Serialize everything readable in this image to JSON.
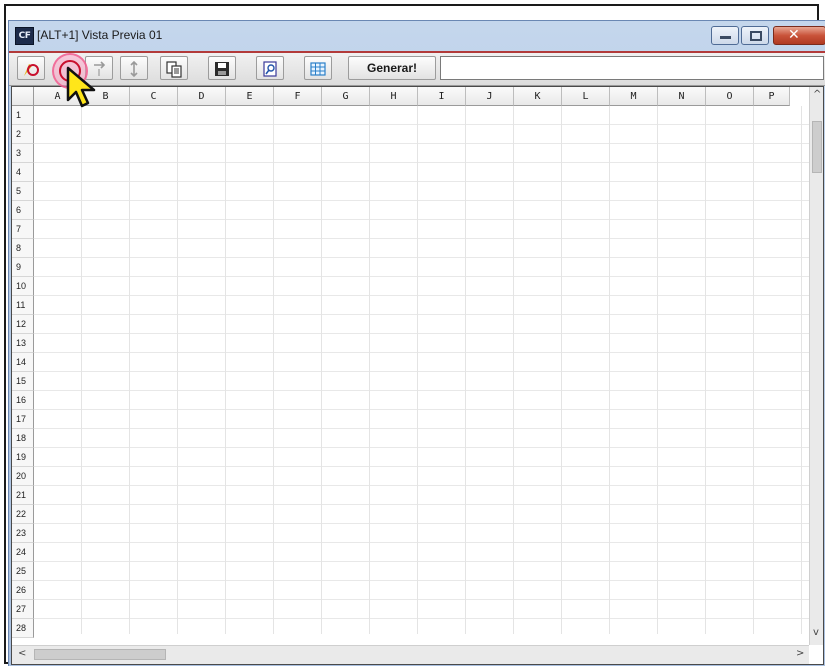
{
  "window": {
    "app_icon_text": "CF",
    "title": "[ALT+1] Vista Previa 01",
    "close_glyph": "✕"
  },
  "toolbar": {
    "buttons": [
      {
        "name": "cancel-icon"
      },
      {
        "name": "sort-arrow-icon"
      },
      {
        "name": "sort-updown-icon"
      },
      {
        "name": "copy-icon"
      },
      {
        "name": "save-icon"
      },
      {
        "name": "preview-icon"
      },
      {
        "name": "grid-icon"
      }
    ],
    "generar_label": "Generar!",
    "input_value": ""
  },
  "grid": {
    "columns": [
      "A",
      "B",
      "C",
      "D",
      "E",
      "F",
      "G",
      "H",
      "I",
      "J",
      "K",
      "L",
      "M",
      "N",
      "O",
      "P"
    ],
    "rows": [
      "1",
      "2",
      "3",
      "4",
      "5",
      "6",
      "7",
      "8",
      "9",
      "10",
      "11",
      "12",
      "13",
      "14",
      "15",
      "16",
      "17",
      "18",
      "19",
      "20",
      "21",
      "22",
      "23",
      "24",
      "25",
      "26",
      "27",
      "28"
    ]
  },
  "scrollbars": {
    "up": "^",
    "down": "v",
    "left": "<",
    "right": ">"
  },
  "colors": {
    "title_gradient": "#b6cbe6",
    "separator_red": "#b23a3a",
    "close_red": "#c9533a",
    "cursor_yellow": "#ffe61a",
    "click_ring": "#f05a8c"
  }
}
